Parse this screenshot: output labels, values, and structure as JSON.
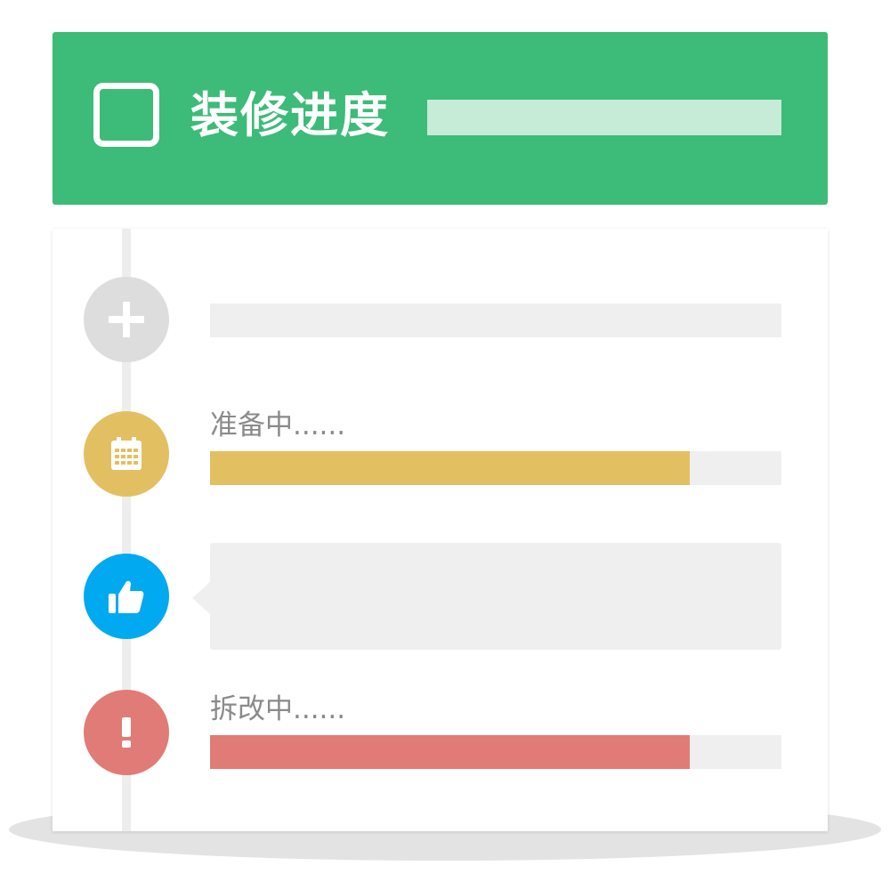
{
  "header": {
    "title": "装修进度",
    "color": "#3dbb78",
    "checkbox_icon": "checkbox-icon"
  },
  "timeline": {
    "items": [
      {
        "icon": "plus-icon",
        "color": "#dddddd"
      },
      {
        "icon": "calendar-icon",
        "color": "#e2c062",
        "label": "准备中......",
        "progress": 0.84,
        "bar_color": "#e2c062"
      },
      {
        "icon": "thumbs-up-icon",
        "color": "#00a9f0"
      },
      {
        "icon": "exclamation-icon",
        "color": "#e07b78",
        "label": "拆改中......",
        "progress": 0.84,
        "bar_color": "#e07b78"
      }
    ]
  }
}
